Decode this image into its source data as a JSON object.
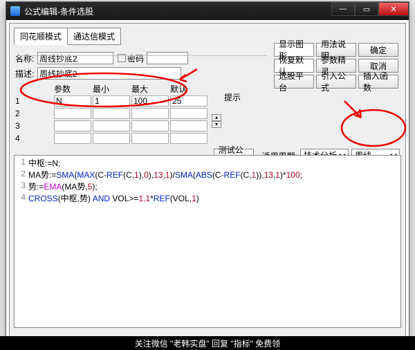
{
  "window": {
    "title": "公式编辑-条件选股"
  },
  "tabs": {
    "t1": "同花顺模式",
    "t2": "通达信模式"
  },
  "fields": {
    "name_label": "名称:",
    "name_value": "周线抄底2",
    "password_label": "密码",
    "desc_label": "描述:",
    "desc_value": "周线抄底2"
  },
  "param": {
    "h1": "参数",
    "h2": "最小",
    "h3": "最大",
    "h4": "默认",
    "rows": [
      {
        "name": "N",
        "min": "1",
        "max": "100",
        "def": "25"
      },
      {
        "name": "",
        "min": "",
        "max": "",
        "def": ""
      },
      {
        "name": "",
        "min": "",
        "max": "",
        "def": ""
      },
      {
        "name": "",
        "min": "",
        "max": "",
        "def": ""
      }
    ],
    "rownum": [
      "1",
      "2",
      "3",
      "4"
    ]
  },
  "hint_label": "提示",
  "buttons": {
    "show_graph": "显示图形",
    "usage": "用法说明",
    "ok": "确定",
    "restore": "恢复默认",
    "wizard": "参数精灵",
    "cancel": "取消",
    "platform": "选股平台",
    "import": "引入公式",
    "insertfn": "插入函数",
    "test": "测试公式"
  },
  "period": {
    "label": "适用周期:",
    "sel1": "技术分析",
    "sel2": "周线"
  },
  "code": [
    [
      [
        "kw-black",
        "中枢:=N;"
      ]
    ],
    [
      [
        "kw-black",
        "MA势:="
      ],
      [
        "kw-blue",
        "SMA"
      ],
      [
        "kw-black",
        "("
      ],
      [
        "kw-blue",
        "MAX"
      ],
      [
        "kw-black",
        "(C-"
      ],
      [
        "kw-blue",
        "REF"
      ],
      [
        "kw-black",
        "(C,"
      ],
      [
        "kw-red",
        "1"
      ],
      [
        "kw-black",
        "),"
      ],
      [
        "kw-red",
        "0"
      ],
      [
        "kw-black",
        "),"
      ],
      [
        "kw-red",
        "13"
      ],
      [
        "kw-black",
        ","
      ],
      [
        "kw-red",
        "1"
      ],
      [
        "kw-black",
        ")/"
      ],
      [
        "kw-blue",
        "SMA"
      ],
      [
        "kw-black",
        "("
      ],
      [
        "kw-blue",
        "ABS"
      ],
      [
        "kw-black",
        "(C-"
      ],
      [
        "kw-blue",
        "REF"
      ],
      [
        "kw-black",
        "(C,"
      ],
      [
        "kw-red",
        "1"
      ],
      [
        "kw-black",
        ")),"
      ],
      [
        "kw-red",
        "13"
      ],
      [
        "kw-black",
        ","
      ],
      [
        "kw-red",
        "1"
      ],
      [
        "kw-black",
        ")*"
      ],
      [
        "kw-red",
        "100"
      ],
      [
        "kw-black",
        ";"
      ]
    ],
    [
      [
        "kw-black",
        "势:="
      ],
      [
        "kw-green",
        "EMA"
      ],
      [
        "kw-black",
        "(MA势,"
      ],
      [
        "kw-red",
        "5"
      ],
      [
        "kw-black",
        ");"
      ]
    ],
    [
      [
        "kw-blue",
        "CROSS"
      ],
      [
        "kw-black",
        "(中枢,势) "
      ],
      [
        "kw-blue",
        "AND"
      ],
      [
        "kw-black",
        " VOL>="
      ],
      [
        "kw-red",
        "1.1"
      ],
      [
        "kw-black",
        "*"
      ],
      [
        "kw-blue",
        "REF"
      ],
      [
        "kw-black",
        "(VOL,"
      ],
      [
        "kw-red",
        "1"
      ],
      [
        "kw-black",
        ")"
      ]
    ]
  ],
  "banner": "关注微信 \"老韩实盘\" 回复 \"指标\" 免费领"
}
